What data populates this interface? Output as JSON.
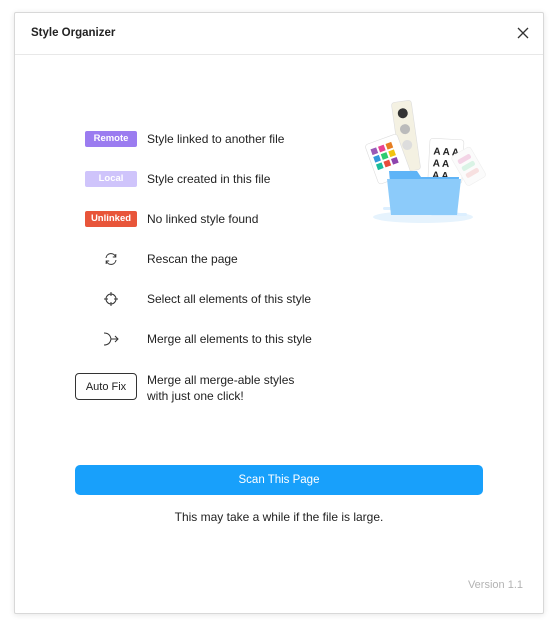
{
  "window": {
    "title": "Style Organizer"
  },
  "legend": [
    {
      "badge": "Remote",
      "badge_color": "#9b7cf0",
      "text": "Style linked to another file"
    },
    {
      "badge": "Local",
      "badge_color": "#cfc4fb",
      "text": "Style created in this file"
    },
    {
      "badge": "Unlinked",
      "badge_color": "#e8553a",
      "text": "No linked style found"
    }
  ],
  "actions": [
    {
      "icon": "rescan-icon",
      "text": "Rescan the page"
    },
    {
      "icon": "target-icon",
      "text": "Select all elements of this style"
    },
    {
      "icon": "merge-arrow-icon",
      "text": "Merge all elements to this style"
    }
  ],
  "autofix": {
    "label": "Auto Fix",
    "text_line1": "Merge all merge-able styles",
    "text_line2": "with just one click!"
  },
  "scan_button": "Scan This Page",
  "note": "This may take a while if the file is large.",
  "version": "Version 1.1",
  "colors": {
    "accent": "#18a0fb"
  }
}
